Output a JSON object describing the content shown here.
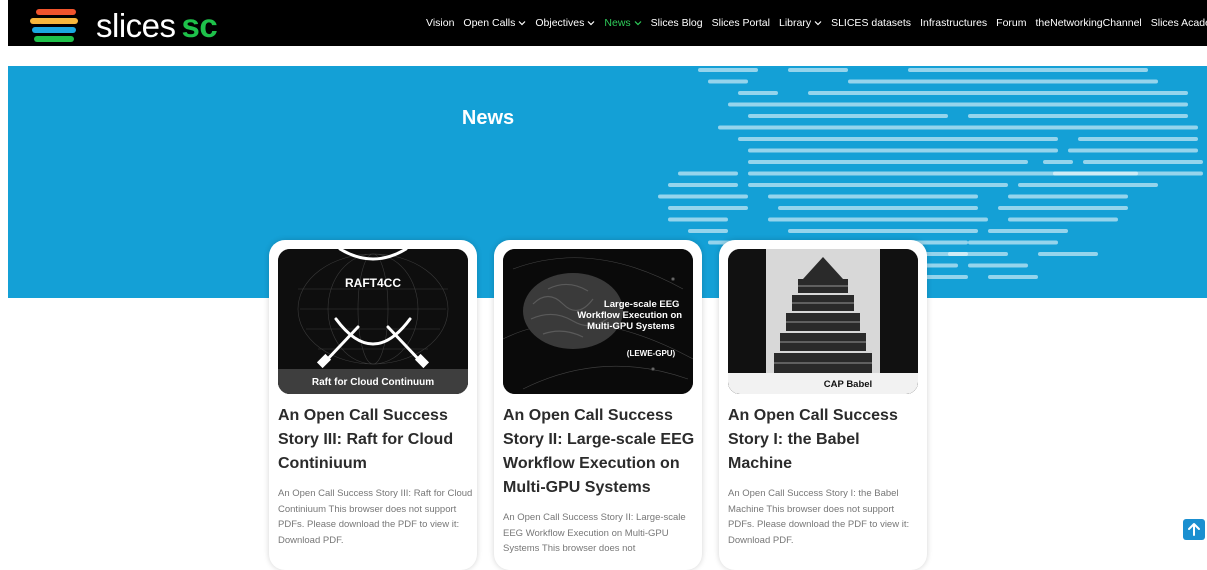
{
  "brand": {
    "name": "slices",
    "suffix": "sc",
    "bar_colors": [
      "#f0542c",
      "#f6b73c",
      "#1aa8e0",
      "#1ec14a"
    ]
  },
  "nav": {
    "items": [
      {
        "label": "Vision",
        "dropdown": false,
        "active": false
      },
      {
        "label": "Open Calls",
        "dropdown": true,
        "active": false
      },
      {
        "label": "Objectives",
        "dropdown": true,
        "active": false
      },
      {
        "label": "News",
        "dropdown": true,
        "active": true
      },
      {
        "label": "Slices Blog",
        "dropdown": false,
        "active": false
      },
      {
        "label": "Slices Portal",
        "dropdown": false,
        "active": false
      },
      {
        "label": "Library",
        "dropdown": true,
        "active": false
      },
      {
        "label": "SLICES datasets",
        "dropdown": false,
        "active": false
      },
      {
        "label": "Infrastructures",
        "dropdown": false,
        "active": false
      },
      {
        "label": "Forum",
        "dropdown": false,
        "active": false
      },
      {
        "label": "theNetworkingChannel",
        "dropdown": false,
        "active": false
      },
      {
        "label": "Slices Academy",
        "dropdown": false,
        "active": false
      }
    ],
    "active_color": "#2ecc59"
  },
  "hero": {
    "title": "News",
    "background": "#14a0d6"
  },
  "cards": [
    {
      "image_label": "RAFT4CC",
      "image_caption": "Raft for Cloud Continuum",
      "title": "An Open Call Success Story III: Raft for Cloud Continiuum",
      "excerpt": "An Open Call Success Story III: Raft for Cloud Continiuum This browser does not support PDFs. Please download the PDF to view it: Download PDF."
    },
    {
      "image_label": "Large-scale EEG Workflow Execution on Multi-GPU Systems",
      "image_caption": "(LEWE-GPU)",
      "title": "An Open Call Success Story II: Large-scale EEG Workflow Execution on Multi-GPU Systems",
      "excerpt": "An Open Call Success Story II: Large-scale EEG Workflow Execution on Multi-GPU Systems This browser does not"
    },
    {
      "image_label": "",
      "image_caption": "CAP Babel",
      "title": "An Open Call Success Story I: the Babel Machine",
      "excerpt": "An Open Call Success Story I: the Babel Machine This browser does not support PDFs. Please download the PDF to view it: Download PDF."
    }
  ],
  "scroll_top": {
    "icon": "arrow-up-icon"
  }
}
